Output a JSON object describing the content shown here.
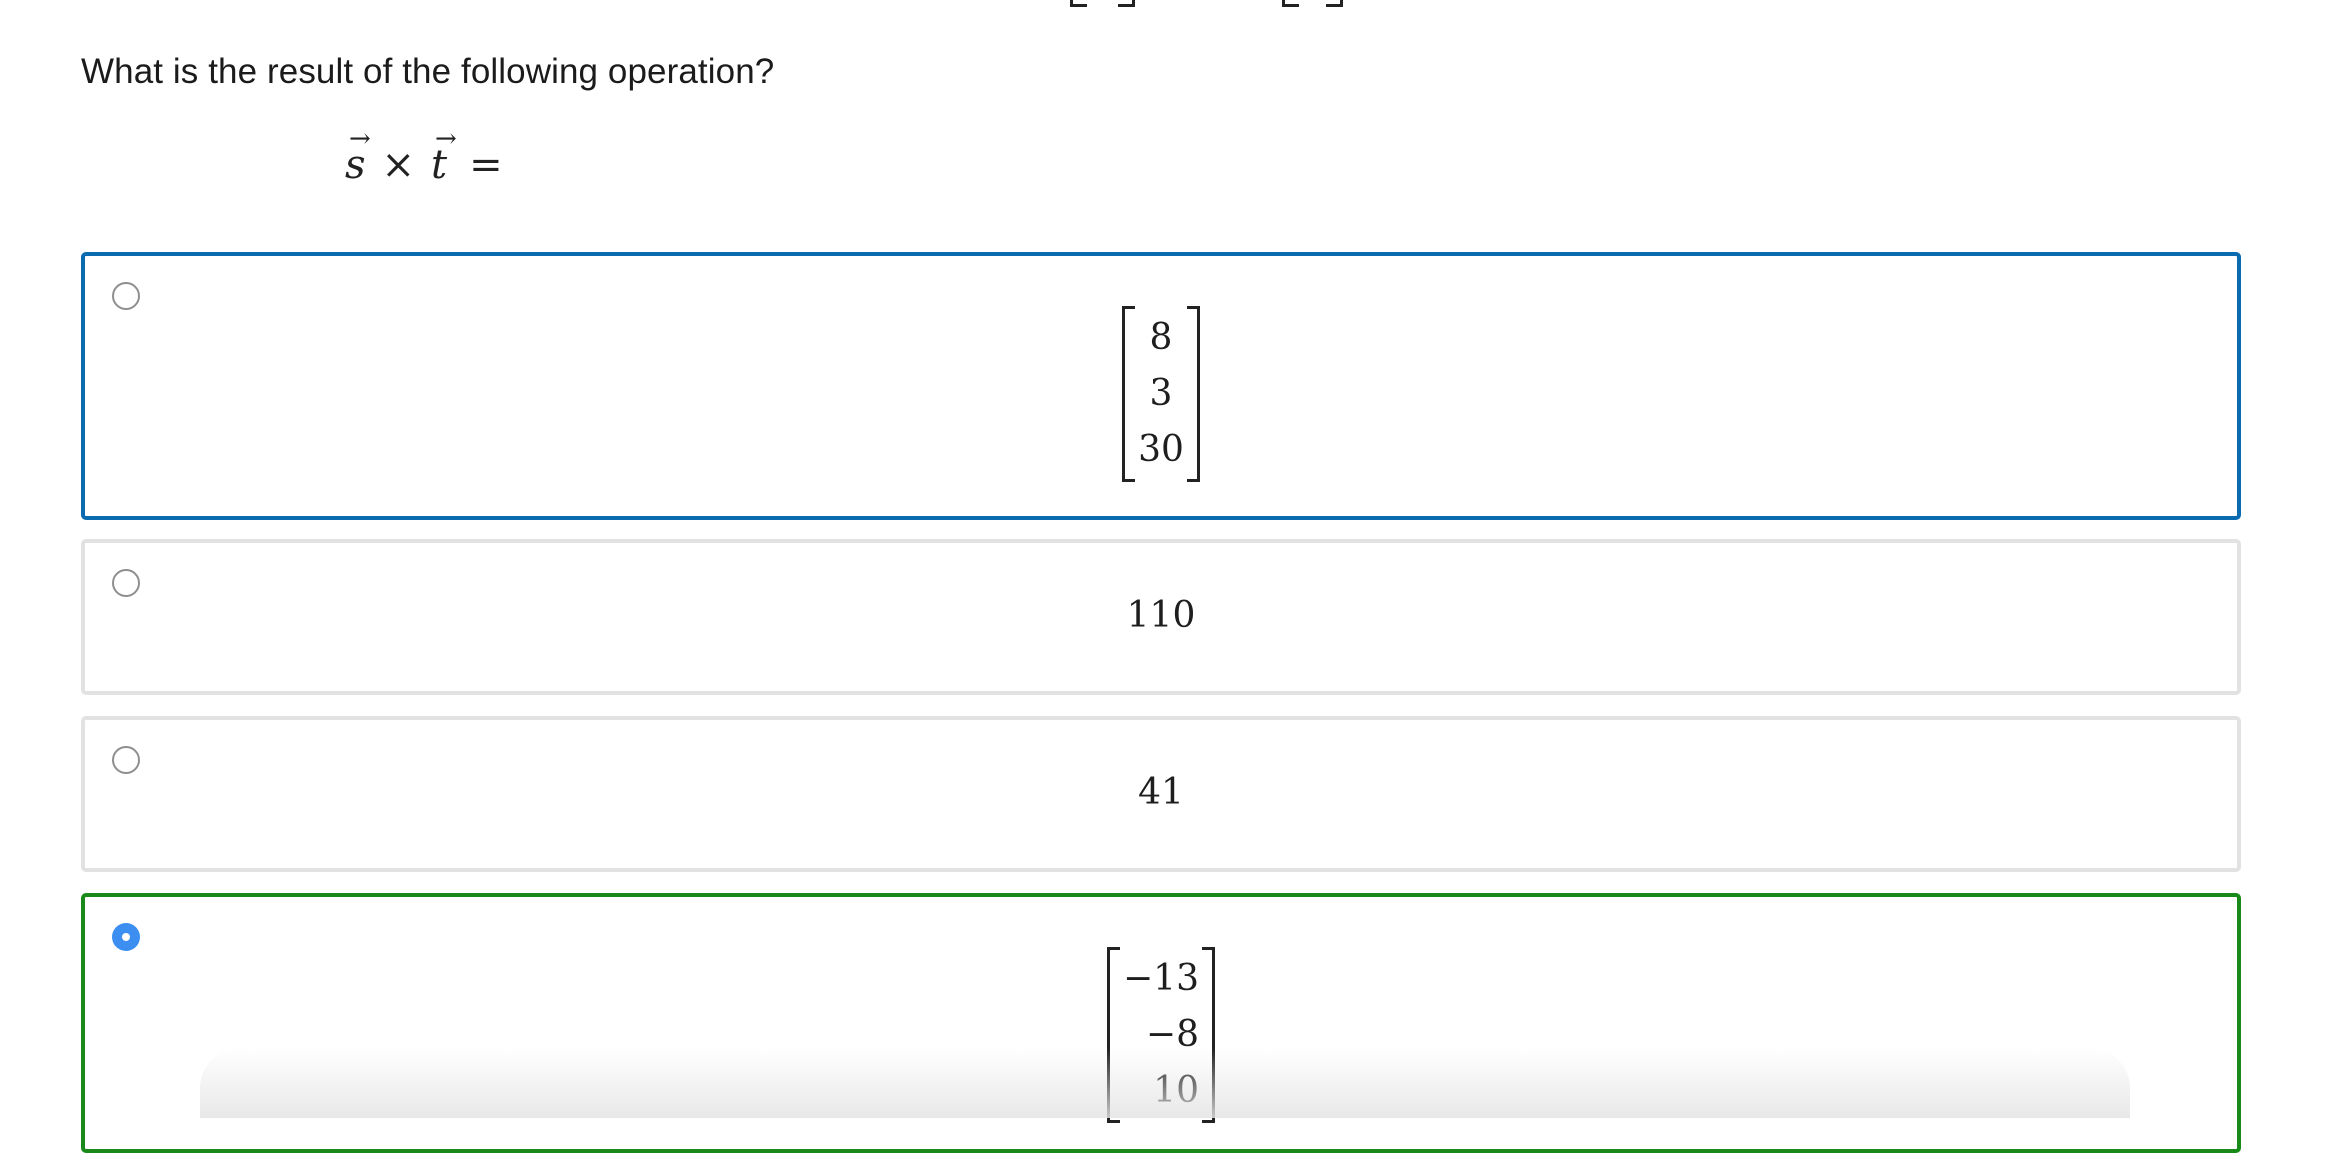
{
  "question": {
    "text": "What is the result of the following operation?"
  },
  "equation": {
    "vector_a": "s",
    "operator": "×",
    "vector_b": "t",
    "equals": "=",
    "arrow": "→"
  },
  "options": [
    {
      "id": "a",
      "type": "vector",
      "values": [
        "8",
        "3",
        "30"
      ],
      "selected": false,
      "state": "hover"
    },
    {
      "id": "b",
      "type": "scalar",
      "value": "110",
      "selected": false,
      "state": "default"
    },
    {
      "id": "c",
      "type": "scalar",
      "value": "41",
      "selected": false,
      "state": "default"
    },
    {
      "id": "d",
      "type": "vector",
      "values": [
        "−13",
        "−8",
        "10"
      ],
      "selected": true,
      "state": "correct"
    }
  ],
  "colors": {
    "hover_border": "#0b6bb0",
    "correct_border": "#198a1a",
    "default_border": "#e2e2e2",
    "radio_checked": "#3c8ff0"
  }
}
